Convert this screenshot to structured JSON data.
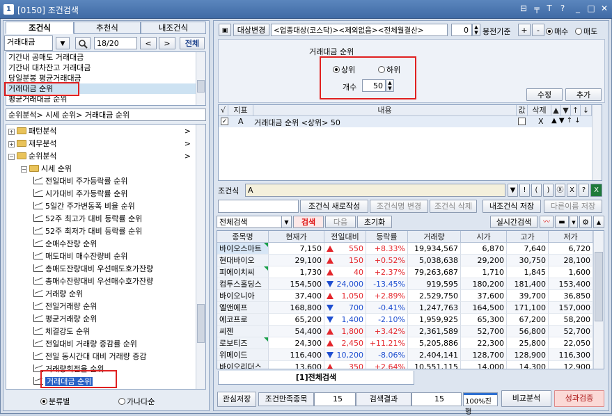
{
  "window": {
    "number": "1",
    "title": "[0150] 조건검색",
    "controls": [
      "⊟",
      "╤",
      "T",
      "?",
      "_",
      "□",
      "✕"
    ]
  },
  "left": {
    "tabs": [
      "조건식",
      "추천식",
      "내조건식"
    ],
    "search_value": "거래대금",
    "page": "18/20",
    "prev": "<",
    "next": ">",
    "all_btn": "전체",
    "results": [
      "기간내 공매도 거래대금",
      "기간내 대차잔고 거래대금",
      "당일분봉 평균거래대금",
      "거래대금 순위",
      "평균거래대금 순위"
    ],
    "path": "순위분석> 시세 순위> 거래대금 순위",
    "tree": [
      {
        "label": "패턴분석",
        "level": 0,
        "expand": "+",
        "arrow": ">"
      },
      {
        "label": "재무분석",
        "level": 0,
        "expand": "+",
        "arrow": ">"
      },
      {
        "label": "순위분석",
        "level": 0,
        "expand": "−",
        "arrow": ">"
      },
      {
        "label": "시세 순위",
        "level": 1,
        "expand": "−",
        "arrow": ""
      },
      {
        "label": "전일대비 주가등락률 순위",
        "level": 2
      },
      {
        "label": "시가대비 주가등락률 순위",
        "level": 2
      },
      {
        "label": "5일간 주가변동폭 비율 순위",
        "level": 2
      },
      {
        "label": "52주 최고가 대비 등락률 순위",
        "level": 2
      },
      {
        "label": "52주 최저가 대비 등락률 순위",
        "level": 2
      },
      {
        "label": "순매수잔량 순위",
        "level": 2
      },
      {
        "label": "매도대비 매수잔량비 순위",
        "level": 2
      },
      {
        "label": "총매도잔량대비 우선매도호가잔량",
        "level": 2
      },
      {
        "label": "총매수잔량대비 우선매수호가잔량",
        "level": 2
      },
      {
        "label": "거래량 순위",
        "level": 2
      },
      {
        "label": "전일거래량 순위",
        "level": 2
      },
      {
        "label": "평균거래량 순위",
        "level": 2
      },
      {
        "label": "체결강도 순위",
        "level": 2
      },
      {
        "label": "전일대비 거래량 증감률 순위",
        "level": 2
      },
      {
        "label": "전일 동시간대 대비 거래량 증감",
        "level": 2
      },
      {
        "label": "거래량회전율 순위",
        "level": 2
      },
      {
        "label": "거래대금 순위",
        "level": 2
      }
    ],
    "radio_a": "분류별",
    "radio_b": "가나다순"
  },
  "right": {
    "target_btn": "대상변경",
    "target_text": "<업종대상(코스닥)><제외없음><전체월결산>",
    "bong_value": "0",
    "bong_label": "봉전기준",
    "plus": "+",
    "minus": "-",
    "buy": "매수",
    "sell": "매도",
    "cond_title": "거래대금 순위",
    "upper": "상위",
    "lower": "하위",
    "count_label": "개수",
    "count_value": "50",
    "edit_btn": "수정",
    "add_btn": "추가",
    "cond_headers": [
      "√",
      "지표",
      "내용",
      "값",
      "삭제",
      "▲",
      "▼",
      "↑",
      "↓"
    ],
    "cond_row": {
      "check": "✓",
      "ind": "A",
      "content": "거래대금 순위 <상위> 50",
      "del": "X"
    },
    "formula_label": "조건식",
    "formula_value": "A",
    "formula_btns": [
      "▼",
      "!",
      "(",
      ")",
      "Ⓧ",
      "X",
      "?"
    ],
    "actions": [
      "조건식 새로작성",
      "조건식명 변경",
      "조건식 삭제",
      "내조건식 저장",
      "다른이름 저장"
    ],
    "search_scope": "전체검색",
    "search_btn": "검색",
    "next_btn": "다음",
    "reset_btn": "초기화",
    "realtime_btn": "실시간검색",
    "table_headers": [
      "종목명",
      "현재가",
      "전일대비",
      "등락률",
      "거래량",
      "시가",
      "고가",
      "저가"
    ],
    "rows": [
      [
        "바이오스마트",
        "7,150",
        "up",
        "550",
        "+8.33%",
        "19,934,567",
        "6,870",
        "7,640",
        "6,720"
      ],
      [
        "현대바이오",
        "29,100",
        "up",
        "150",
        "+0.52%",
        "5,038,638",
        "29,200",
        "30,750",
        "28,100"
      ],
      [
        "피에이치씨",
        "1,730",
        "up",
        "40",
        "+2.37%",
        "79,263,687",
        "1,710",
        "1,845",
        "1,600"
      ],
      [
        "컴투스홀딩스",
        "154,500",
        "dn",
        "24,000",
        "-13.45%",
        "919,595",
        "180,200",
        "181,400",
        "153,400"
      ],
      [
        "바이오니아",
        "37,400",
        "up",
        "1,050",
        "+2.89%",
        "2,529,750",
        "37,600",
        "39,700",
        "36,850"
      ],
      [
        "엘앤에프",
        "168,800",
        "dn",
        "700",
        "-0.41%",
        "1,247,763",
        "164,500",
        "171,100",
        "157,000"
      ],
      [
        "에코프로",
        "65,200",
        "dn",
        "1,400",
        "-2.10%",
        "1,959,925",
        "65,300",
        "67,200",
        "58,200"
      ],
      [
        "씨젠",
        "54,400",
        "up",
        "1,800",
        "+3.42%",
        "2,361,589",
        "52,700",
        "56,800",
        "52,700"
      ],
      [
        "로보티즈",
        "24,300",
        "up",
        "2,450",
        "+11.21%",
        "5,205,886",
        "22,300",
        "25,800",
        "22,050"
      ],
      [
        "위메이드",
        "116,400",
        "dn",
        "10,200",
        "-8.06%",
        "2,404,141",
        "128,700",
        "128,900",
        "116,300"
      ],
      [
        "바이오리더스",
        "13,600",
        "up",
        "350",
        "+2.64%",
        "10,551,115",
        "14,000",
        "14,300",
        "12,900"
      ]
    ],
    "result_tab": "[1]전체검색",
    "footer": {
      "save_btn": "관심저장",
      "satisfy_label": "조건만족종목",
      "satisfy_val": "15",
      "result_label": "검색결과",
      "result_val": "15",
      "progress": "100%진행",
      "progress_pct": 100,
      "compare_btn": "비교분석",
      "verify_btn": "성과검증"
    }
  }
}
